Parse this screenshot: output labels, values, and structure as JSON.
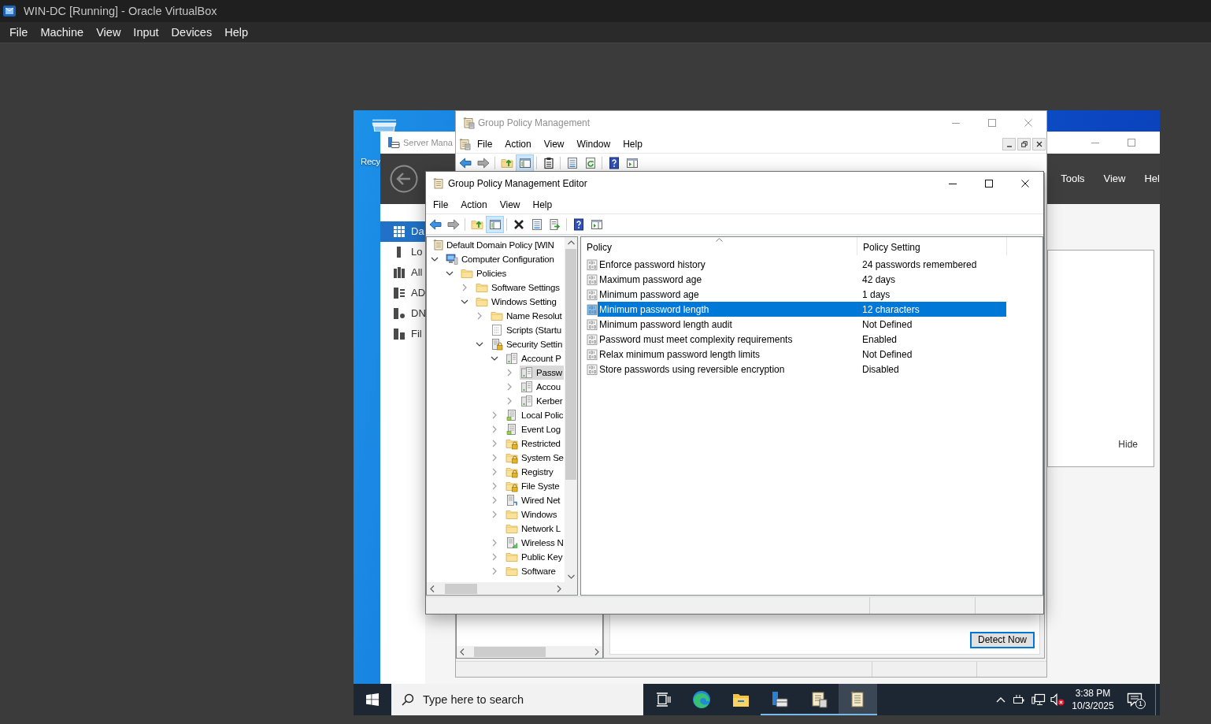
{
  "window": {
    "title": "WIN-DC [Running] - Oracle VirtualBox"
  },
  "menu_bar": [
    "File",
    "Machine",
    "View",
    "Input",
    "Devices",
    "Help"
  ],
  "desktop": {
    "icons": [
      {
        "label": "Recy"
      }
    ]
  },
  "server_manager": {
    "title": "Server Mana",
    "active": false,
    "header_menu": [
      "Tools",
      "View",
      "Hel"
    ],
    "sidebar": {
      "items": [
        {
          "label": "Da",
          "kind": "dashboard",
          "selected": true
        },
        {
          "label": "Lo",
          "kind": "server",
          "selected": false
        },
        {
          "label": "All",
          "kind": "servers",
          "selected": false
        },
        {
          "label": "AD",
          "kind": "directory",
          "selected": false
        },
        {
          "label": "DN",
          "kind": "dns",
          "selected": false
        },
        {
          "label": "Fil",
          "kind": "storage",
          "selected": false
        }
      ]
    },
    "panel": {
      "link": "Hide"
    }
  },
  "group_policy_management": {
    "title": "Group Policy Management",
    "active": false,
    "menu": [
      "File",
      "Action",
      "View",
      "Window",
      "Help"
    ],
    "toolbar": [
      [
        {
          "kind": "back",
          "disabled": false,
          "pressed": false
        },
        {
          "kind": "forward",
          "disabled": true,
          "pressed": false
        }
      ],
      [
        {
          "kind": "up",
          "disabled": false,
          "pressed": false
        },
        {
          "kind": "tree",
          "disabled": false,
          "pressed": true
        }
      ],
      [
        {
          "kind": "clipboard",
          "disabled": false,
          "pressed": false
        }
      ],
      [
        {
          "kind": "properties",
          "disabled": false,
          "pressed": false
        },
        {
          "kind": "refresh",
          "disabled": false,
          "pressed": false
        }
      ],
      [
        {
          "kind": "help",
          "disabled": false,
          "pressed": false
        },
        {
          "kind": "pane",
          "disabled": false,
          "pressed": false
        }
      ]
    ],
    "detect_button": "Detect Now"
  },
  "editor": {
    "title": "Group Policy Management Editor",
    "active": true,
    "menu": [
      "File",
      "Action",
      "View",
      "Help"
    ],
    "toolbar": [
      [
        {
          "kind": "back",
          "disabled": false,
          "pressed": false
        },
        {
          "kind": "forward",
          "disabled": true,
          "pressed": false
        }
      ],
      [
        {
          "kind": "up",
          "disabled": false,
          "pressed": false
        },
        {
          "kind": "tree",
          "disabled": false,
          "pressed": true
        }
      ],
      [
        {
          "kind": "delete",
          "disabled": false,
          "pressed": false
        },
        {
          "kind": "properties",
          "disabled": false,
          "pressed": false
        },
        {
          "kind": "export",
          "disabled": false,
          "pressed": false
        }
      ],
      [
        {
          "kind": "help",
          "disabled": false,
          "pressed": false
        },
        {
          "kind": "pane",
          "disabled": false,
          "pressed": false
        }
      ]
    ],
    "tree": [
      {
        "label": "Default Domain Policy [WIN",
        "kind": "policy",
        "selected": false,
        "children": [
          {
            "label": "Computer Configuration",
            "kind": "computer",
            "selected": false,
            "expanded": true,
            "children": [
              {
                "label": "Policies",
                "kind": "folder",
                "selected": false,
                "expanded": true,
                "children": [
                  {
                    "label": "Software Settings",
                    "kind": "folder",
                    "selected": false,
                    "expanded": false
                  },
                  {
                    "label": "Windows Setting",
                    "kind": "folder",
                    "selected": false,
                    "expanded": true,
                    "children": [
                      {
                        "label": "Name Resolut",
                        "kind": "folder",
                        "selected": false,
                        "expanded": false
                      },
                      {
                        "label": "Scripts (Startu",
                        "kind": "script",
                        "selected": false
                      },
                      {
                        "label": "Security Settin",
                        "kind": "security",
                        "selected": false,
                        "expanded": true,
                        "children": [
                          {
                            "label": "Account P",
                            "kind": "policy-group",
                            "selected": false,
                            "expanded": true,
                            "children": [
                              {
                                "label": "Passw",
                                "kind": "policy-group",
                                "selected": true,
                                "expanded": false
                              },
                              {
                                "label": "Accou",
                                "kind": "policy-group",
                                "selected": false,
                                "expanded": false
                              },
                              {
                                "label": "Kerber",
                                "kind": "policy-group",
                                "selected": false,
                                "expanded": false
                              }
                            ]
                          },
                          {
                            "label": "Local Polic",
                            "kind": "log",
                            "selected": false,
                            "expanded": false
                          },
                          {
                            "label": "Event Log",
                            "kind": "log",
                            "selected": false,
                            "expanded": false
                          },
                          {
                            "label": "Restricted",
                            "kind": "locked-folder",
                            "selected": false,
                            "expanded": false
                          },
                          {
                            "label": "System Se",
                            "kind": "locked-folder",
                            "selected": false,
                            "expanded": false
                          },
                          {
                            "label": "Registry",
                            "kind": "locked-folder",
                            "selected": false,
                            "expanded": false
                          },
                          {
                            "label": "File Syste",
                            "kind": "locked-folder",
                            "selected": false,
                            "expanded": false
                          },
                          {
                            "label": "Wired Net",
                            "kind": "wired",
                            "selected": false,
                            "expanded": false
                          },
                          {
                            "label": "Windows",
                            "kind": "folder",
                            "selected": false,
                            "expanded": false
                          },
                          {
                            "label": "Network L",
                            "kind": "folder",
                            "selected": false
                          },
                          {
                            "label": "Wireless N",
                            "kind": "wireless",
                            "selected": false,
                            "expanded": false
                          },
                          {
                            "label": "Public Key",
                            "kind": "folder",
                            "selected": false,
                            "expanded": false
                          },
                          {
                            "label": "Software",
                            "kind": "folder",
                            "selected": false,
                            "expanded": false
                          }
                        ]
                      }
                    ]
                  }
                ]
              }
            ]
          }
        ]
      }
    ],
    "table": {
      "columns": [
        {
          "label": "Policy",
          "sorted": true
        },
        {
          "label": "Policy Setting",
          "sorted": false
        }
      ],
      "rows": [
        {
          "policy": "Enforce password history",
          "setting": "24 passwords remembered",
          "selected": false
        },
        {
          "policy": "Maximum password age",
          "setting": "42 days",
          "selected": false
        },
        {
          "policy": "Minimum password age",
          "setting": "1 days",
          "selected": false
        },
        {
          "policy": "Minimum password length",
          "setting": "12 characters",
          "selected": true
        },
        {
          "policy": "Minimum password length audit",
          "setting": "Not Defined",
          "selected": false
        },
        {
          "policy": "Password must meet complexity requirements",
          "setting": "Enabled",
          "selected": false
        },
        {
          "policy": "Relax minimum password length limits",
          "setting": "Not Defined",
          "selected": false
        },
        {
          "policy": "Store passwords using reversible encryption",
          "setting": "Disabled",
          "selected": false
        }
      ]
    }
  },
  "taskbar": {
    "search": {
      "placeholder": "Type here to search"
    },
    "apps": [
      {
        "kind": "task-view",
        "open": false,
        "active": false
      },
      {
        "kind": "browser",
        "open": false,
        "active": false
      },
      {
        "kind": "explorer",
        "open": false,
        "active": false
      },
      {
        "kind": "server-manager",
        "open": true,
        "active": false
      },
      {
        "kind": "policy-console",
        "open": true,
        "active": false
      },
      {
        "kind": "policy-editor",
        "open": true,
        "active": true
      }
    ],
    "volume": {
      "muted": true
    },
    "clock": {
      "time": "3:38 PM",
      "date": "10/3/2025"
    },
    "notifications": {
      "count": "1"
    }
  }
}
